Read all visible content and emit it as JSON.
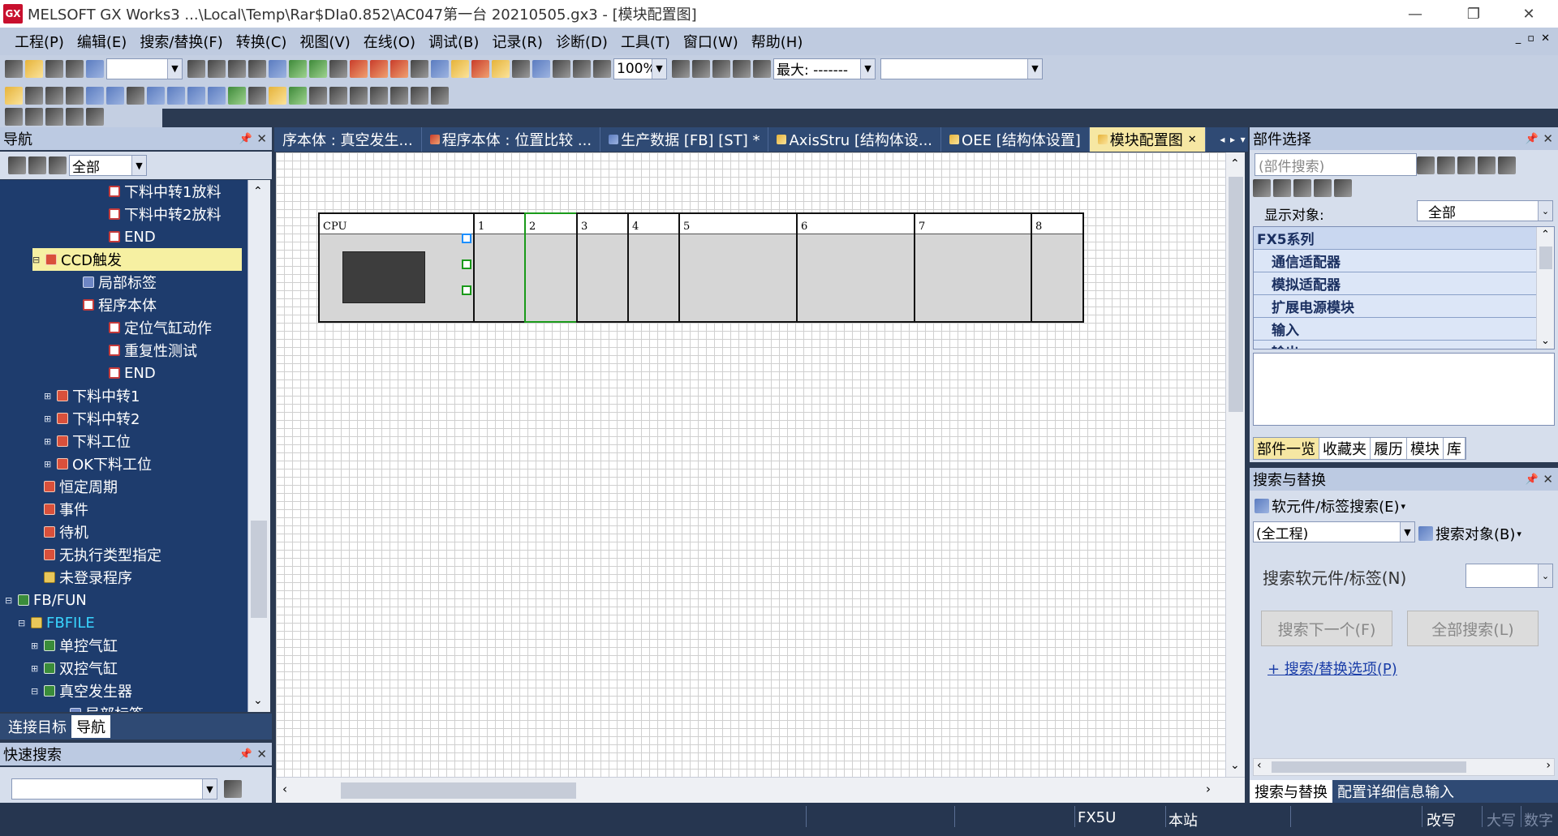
{
  "window": {
    "title": "MELSOFT GX Works3 ...\\Local\\Temp\\Rar$DIa0.852\\AC047第一台  20210505.gx3 - [模块配置图]",
    "app_icon_text": "GX",
    "controls": [
      "—",
      "❐",
      "✕"
    ]
  },
  "menu": {
    "items": [
      "工程(P)",
      "编辑(E)",
      "搜索/替换(F)",
      "转换(C)",
      "视图(V)",
      "在线(O)",
      "调试(B)",
      "记录(R)",
      "诊断(D)",
      "工具(T)",
      "窗口(W)",
      "帮助(H)"
    ],
    "mdi_controls": [
      "_",
      "▫",
      "✕"
    ]
  },
  "toolbar": {
    "zoom_value": "100%",
    "max_label": "最大: -------",
    "blank_combo": ""
  },
  "navigation": {
    "header": "导航",
    "filter": "全部",
    "tree": [
      {
        "label": "下料中转1放料",
        "level": 7,
        "icon": "doc"
      },
      {
        "label": "下料中转2放料",
        "level": 7,
        "icon": "doc"
      },
      {
        "label": "END",
        "level": 7,
        "icon": "doc"
      },
      {
        "label": "CCD触发",
        "level": 3,
        "icon": "prog",
        "expander": "⊟",
        "selected": true
      },
      {
        "label": "局部标签",
        "level": 5,
        "icon": "lbl"
      },
      {
        "label": "程序本体",
        "level": 5,
        "icon": "doc"
      },
      {
        "label": "定位气缸动作",
        "level": 7,
        "icon": "doc"
      },
      {
        "label": "重复性测试",
        "level": 7,
        "icon": "doc"
      },
      {
        "label": "END",
        "level": 7,
        "icon": "doc"
      },
      {
        "label": "下料中转1",
        "level": 3,
        "icon": "prog",
        "expander": "⊞"
      },
      {
        "label": "下料中转2",
        "level": 3,
        "icon": "prog",
        "expander": "⊞"
      },
      {
        "label": "下料工位",
        "level": 3,
        "icon": "prog",
        "expander": "⊞"
      },
      {
        "label": "OK下料工位",
        "level": 3,
        "icon": "prog",
        "expander": "⊞"
      },
      {
        "label": "恒定周期",
        "level": 2,
        "icon": "prog"
      },
      {
        "label": "事件",
        "level": 2,
        "icon": "prog"
      },
      {
        "label": "待机",
        "level": 2,
        "icon": "prog"
      },
      {
        "label": "无执行类型指定",
        "level": 2,
        "icon": "prog"
      },
      {
        "label": "未登录程序",
        "level": 2,
        "icon": "fold"
      },
      {
        "label": "FB/FUN",
        "level": 0,
        "icon": "fb",
        "expander": "⊟"
      },
      {
        "label": "FBFILE",
        "level": 1,
        "icon": "fold",
        "expander": "⊟",
        "accent": true
      },
      {
        "label": "单控气缸",
        "level": 2,
        "icon": "fb",
        "expander": "⊞"
      },
      {
        "label": "双控气缸",
        "level": 2,
        "icon": "fb",
        "expander": "⊞"
      },
      {
        "label": "真空发生器",
        "level": 2,
        "icon": "fb",
        "expander": "⊟"
      },
      {
        "label": "局部标签",
        "level": 4,
        "icon": "lbl"
      }
    ],
    "bottom_tabs": [
      "连接目标",
      "导航"
    ]
  },
  "quick_search": {
    "header": "快速搜索",
    "value": ""
  },
  "editor": {
    "tabs": [
      "序本体 : 真空发生...",
      "程序本体 : 位置比较 ...",
      "生产数据 [FB] [ST] *",
      "AxisStru [结构体设...",
      "OEE [结构体设置]",
      "模块配置图"
    ],
    "active_tab": 5,
    "slots": [
      "CPU",
      "1",
      "2",
      "3",
      "4",
      "5",
      "6",
      "7",
      "8"
    ]
  },
  "parts": {
    "header": "部件选择",
    "search_placeholder": "(部件搜索)",
    "display_label": "显示对象:",
    "display_value": "全部",
    "series": "FX5系列",
    "items": [
      "通信适配器",
      "模拟适配器",
      "扩展电源模块",
      "输入",
      "输出"
    ],
    "tabs": [
      "部件一览",
      "收藏夹",
      "履历",
      "模块",
      "库"
    ]
  },
  "search": {
    "header": "搜索与替换",
    "mode": "软元件/标签搜索(E)",
    "scope": "(全工程)",
    "target": "搜索对象(B)",
    "field_label": "搜索软元件/标签(N)",
    "field_value": "",
    "next_button": "搜索下一个(F)",
    "all_button": "全部搜索(L)",
    "options_link": "+ 搜索/替换选项(P)",
    "bottom_tabs": [
      "搜索与替换",
      "配置详细信息输入"
    ]
  },
  "status": {
    "model": "FX5U",
    "station": "本站",
    "mode": "改写",
    "caps": "大写",
    "num": "数字"
  }
}
